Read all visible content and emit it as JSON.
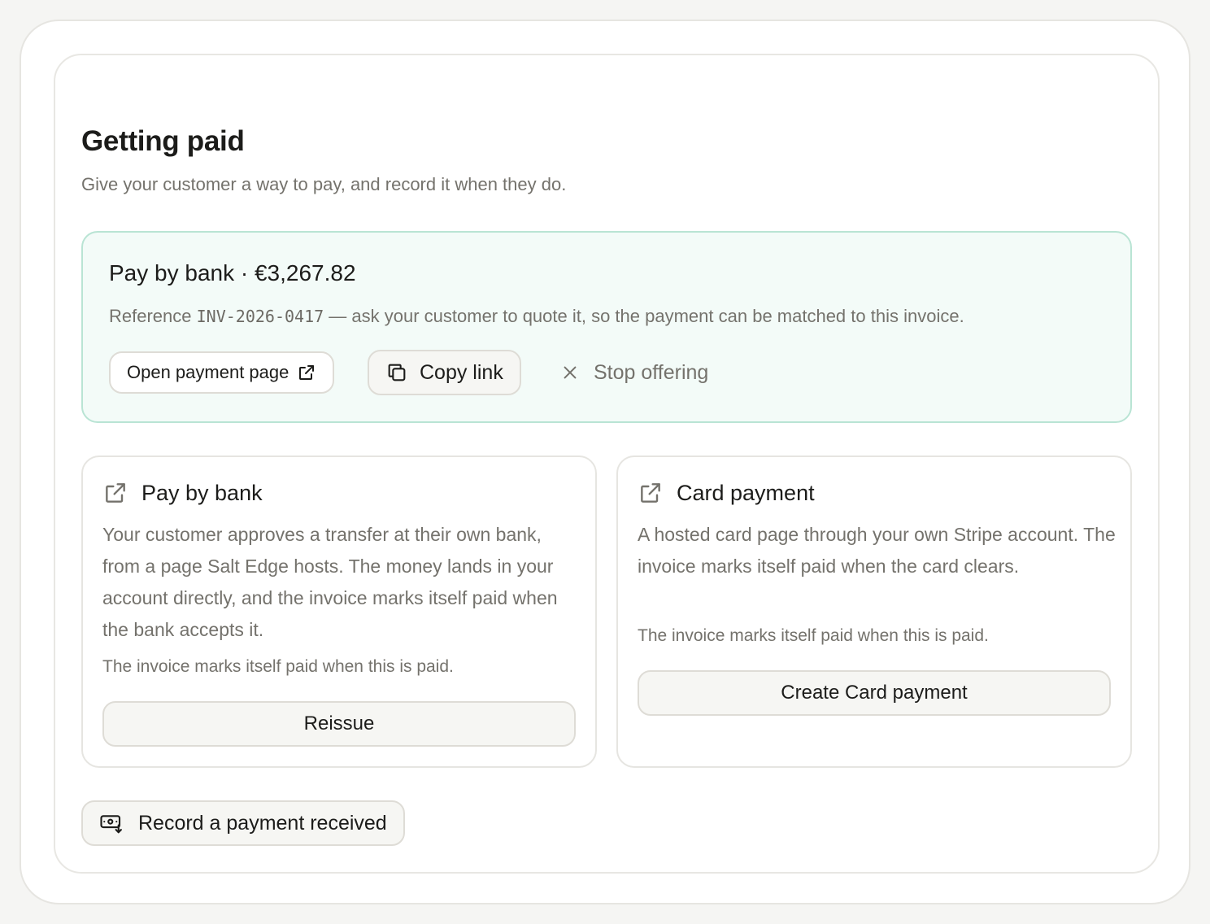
{
  "section": {
    "title": "Getting paid",
    "subtitle": "Give your customer a way to pay, and record it when they do."
  },
  "active_offer": {
    "title": "Pay by bank · €3,267.82",
    "reference_prefix": "Reference ",
    "reference_code": "INV-2026-0417",
    "reference_suffix": " — ask your customer to quote it, so the payment can be matched to this invoice.",
    "open_label": "Open payment page",
    "copy_label": "Copy link",
    "stop_label": "Stop offering",
    "icons": {
      "open": "external-link-icon",
      "copy": "copy-icon",
      "stop": "close-icon"
    }
  },
  "methods": [
    {
      "icon": "external-link-icon",
      "title": "Pay by bank",
      "description": "Your customer approves a transfer at their own bank, from a page Salt Edge hosts. The money lands in your account directly, and the invoice marks itself paid when the bank accepts it.",
      "note": "The invoice marks itself paid when this is paid.",
      "action_label": "Reissue"
    },
    {
      "icon": "external-link-icon",
      "title": "Card payment",
      "description": "A hosted card page through your own Stripe account. The invoice marks itself paid when the card clears.",
      "note": "The invoice marks itself paid when this is paid.",
      "action_label": "Create Card payment"
    }
  ],
  "record": {
    "icon": "money-in-icon",
    "label": "Record a payment received"
  },
  "colors": {
    "accent_bg": "#f3fbf8",
    "accent_border": "#b9e4d4",
    "muted_text": "#74726c",
    "text": "#1c1c1a"
  }
}
